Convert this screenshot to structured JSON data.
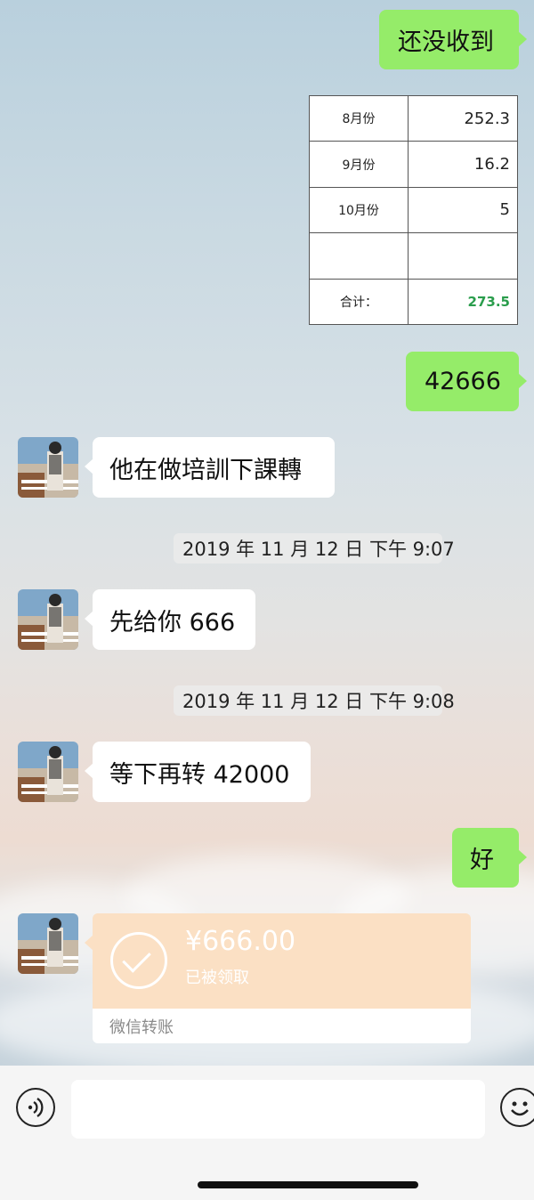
{
  "messages": {
    "m1": "还没收到",
    "m2": "42666",
    "m3": "他在做培訓下課轉",
    "m4": "先给你 666",
    "m5": "等下再转 42000",
    "m6": "好"
  },
  "timestamps": {
    "t1": "2019 年 11 月 12 日 下午 9:07",
    "t2": "2019 年 11 月 12 日 下午 9:08"
  },
  "table": {
    "rows": [
      {
        "month": "8月份",
        "value": "252.3"
      },
      {
        "month": "9月份",
        "value": "16.2"
      },
      {
        "month": "10月份",
        "value": "5"
      },
      {
        "month": "",
        "value": ""
      }
    ],
    "total_label": "合计：",
    "total_value": "273.5"
  },
  "transfer": {
    "amount": "¥666.00",
    "status": "已被领取",
    "footer": "微信转账",
    "card_color": "#fbe0c4"
  },
  "colors": {
    "sent_bubble": "#95ec69",
    "received_bubble": "#ffffff"
  },
  "input_bar": {
    "voice_icon": "voice-icon",
    "emoji_icon": "emoji-icon"
  }
}
